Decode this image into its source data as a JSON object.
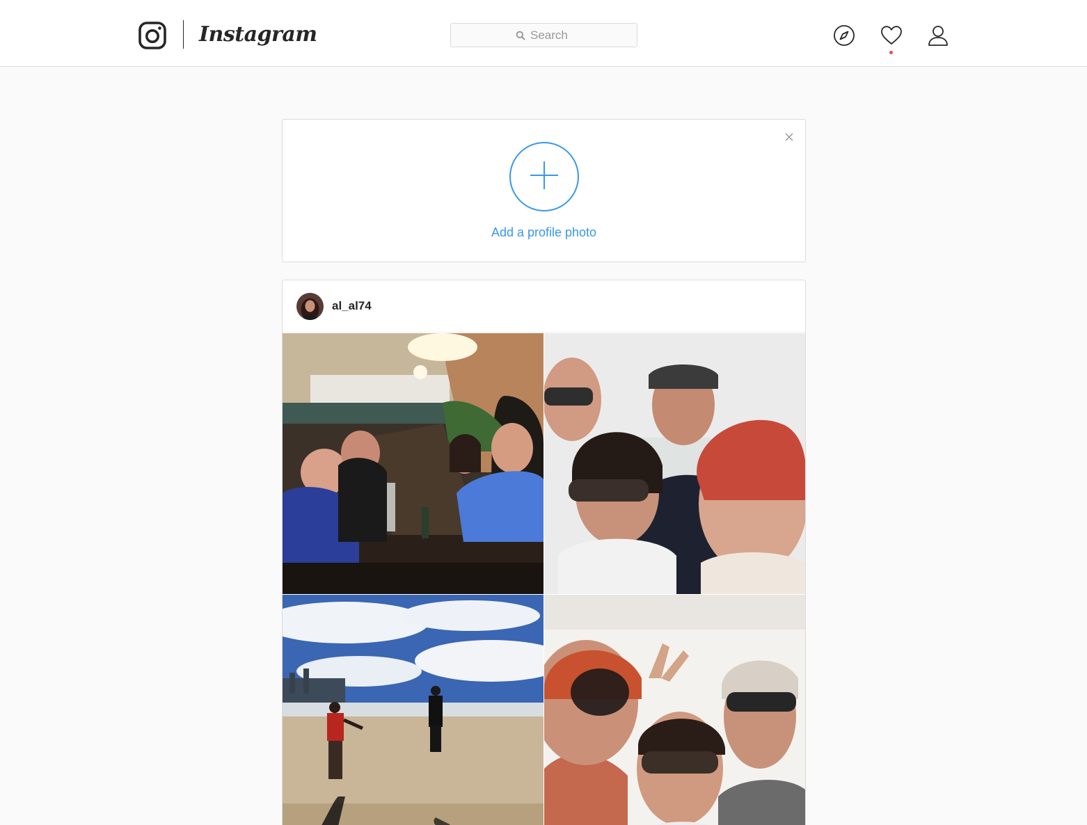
{
  "header": {
    "wordmark": "Instagram",
    "search_placeholder": "Search",
    "icons": [
      "instagram-camera-icon",
      "search-icon",
      "compass-icon",
      "heart-icon",
      "person-icon"
    ],
    "notification_dot_color": "#ed4956"
  },
  "profile_prompt": {
    "add_label": "Add a profile photo",
    "icons": [
      "close-icon",
      "plus-icon"
    ],
    "accent_color": "#3897f0"
  },
  "post": {
    "username": "al_al74",
    "photo_count": 4
  }
}
